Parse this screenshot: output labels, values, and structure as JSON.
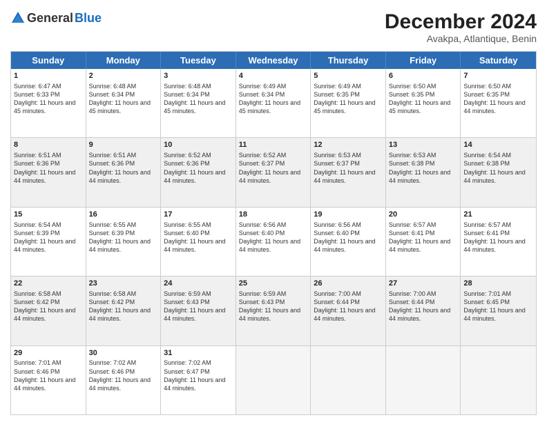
{
  "logo": {
    "general": "General",
    "blue": "Blue"
  },
  "title": {
    "month": "December 2024",
    "location": "Avakpa, Atlantique, Benin"
  },
  "header_days": [
    "Sunday",
    "Monday",
    "Tuesday",
    "Wednesday",
    "Thursday",
    "Friday",
    "Saturday"
  ],
  "rows": [
    [
      {
        "day": "1",
        "sunrise": "Sunrise: 6:47 AM",
        "sunset": "Sunset: 6:33 PM",
        "daylight": "Daylight: 11 hours and 45 minutes."
      },
      {
        "day": "2",
        "sunrise": "Sunrise: 6:48 AM",
        "sunset": "Sunset: 6:34 PM",
        "daylight": "Daylight: 11 hours and 45 minutes."
      },
      {
        "day": "3",
        "sunrise": "Sunrise: 6:48 AM",
        "sunset": "Sunset: 6:34 PM",
        "daylight": "Daylight: 11 hours and 45 minutes."
      },
      {
        "day": "4",
        "sunrise": "Sunrise: 6:49 AM",
        "sunset": "Sunset: 6:34 PM",
        "daylight": "Daylight: 11 hours and 45 minutes."
      },
      {
        "day": "5",
        "sunrise": "Sunrise: 6:49 AM",
        "sunset": "Sunset: 6:35 PM",
        "daylight": "Daylight: 11 hours and 45 minutes."
      },
      {
        "day": "6",
        "sunrise": "Sunrise: 6:50 AM",
        "sunset": "Sunset: 6:35 PM",
        "daylight": "Daylight: 11 hours and 45 minutes."
      },
      {
        "day": "7",
        "sunrise": "Sunrise: 6:50 AM",
        "sunset": "Sunset: 6:35 PM",
        "daylight": "Daylight: 11 hours and 44 minutes."
      }
    ],
    [
      {
        "day": "8",
        "sunrise": "Sunrise: 6:51 AM",
        "sunset": "Sunset: 6:36 PM",
        "daylight": "Daylight: 11 hours and 44 minutes."
      },
      {
        "day": "9",
        "sunrise": "Sunrise: 6:51 AM",
        "sunset": "Sunset: 6:36 PM",
        "daylight": "Daylight: 11 hours and 44 minutes."
      },
      {
        "day": "10",
        "sunrise": "Sunrise: 6:52 AM",
        "sunset": "Sunset: 6:36 PM",
        "daylight": "Daylight: 11 hours and 44 minutes."
      },
      {
        "day": "11",
        "sunrise": "Sunrise: 6:52 AM",
        "sunset": "Sunset: 6:37 PM",
        "daylight": "Daylight: 11 hours and 44 minutes."
      },
      {
        "day": "12",
        "sunrise": "Sunrise: 6:53 AM",
        "sunset": "Sunset: 6:37 PM",
        "daylight": "Daylight: 11 hours and 44 minutes."
      },
      {
        "day": "13",
        "sunrise": "Sunrise: 6:53 AM",
        "sunset": "Sunset: 6:38 PM",
        "daylight": "Daylight: 11 hours and 44 minutes."
      },
      {
        "day": "14",
        "sunrise": "Sunrise: 6:54 AM",
        "sunset": "Sunset: 6:38 PM",
        "daylight": "Daylight: 11 hours and 44 minutes."
      }
    ],
    [
      {
        "day": "15",
        "sunrise": "Sunrise: 6:54 AM",
        "sunset": "Sunset: 6:39 PM",
        "daylight": "Daylight: 11 hours and 44 minutes."
      },
      {
        "day": "16",
        "sunrise": "Sunrise: 6:55 AM",
        "sunset": "Sunset: 6:39 PM",
        "daylight": "Daylight: 11 hours and 44 minutes."
      },
      {
        "day": "17",
        "sunrise": "Sunrise: 6:55 AM",
        "sunset": "Sunset: 6:40 PM",
        "daylight": "Daylight: 11 hours and 44 minutes."
      },
      {
        "day": "18",
        "sunrise": "Sunrise: 6:56 AM",
        "sunset": "Sunset: 6:40 PM",
        "daylight": "Daylight: 11 hours and 44 minutes."
      },
      {
        "day": "19",
        "sunrise": "Sunrise: 6:56 AM",
        "sunset": "Sunset: 6:40 PM",
        "daylight": "Daylight: 11 hours and 44 minutes."
      },
      {
        "day": "20",
        "sunrise": "Sunrise: 6:57 AM",
        "sunset": "Sunset: 6:41 PM",
        "daylight": "Daylight: 11 hours and 44 minutes."
      },
      {
        "day": "21",
        "sunrise": "Sunrise: 6:57 AM",
        "sunset": "Sunset: 6:41 PM",
        "daylight": "Daylight: 11 hours and 44 minutes."
      }
    ],
    [
      {
        "day": "22",
        "sunrise": "Sunrise: 6:58 AM",
        "sunset": "Sunset: 6:42 PM",
        "daylight": "Daylight: 11 hours and 44 minutes."
      },
      {
        "day": "23",
        "sunrise": "Sunrise: 6:58 AM",
        "sunset": "Sunset: 6:42 PM",
        "daylight": "Daylight: 11 hours and 44 minutes."
      },
      {
        "day": "24",
        "sunrise": "Sunrise: 6:59 AM",
        "sunset": "Sunset: 6:43 PM",
        "daylight": "Daylight: 11 hours and 44 minutes."
      },
      {
        "day": "25",
        "sunrise": "Sunrise: 6:59 AM",
        "sunset": "Sunset: 6:43 PM",
        "daylight": "Daylight: 11 hours and 44 minutes."
      },
      {
        "day": "26",
        "sunrise": "Sunrise: 7:00 AM",
        "sunset": "Sunset: 6:44 PM",
        "daylight": "Daylight: 11 hours and 44 minutes."
      },
      {
        "day": "27",
        "sunrise": "Sunrise: 7:00 AM",
        "sunset": "Sunset: 6:44 PM",
        "daylight": "Daylight: 11 hours and 44 minutes."
      },
      {
        "day": "28",
        "sunrise": "Sunrise: 7:01 AM",
        "sunset": "Sunset: 6:45 PM",
        "daylight": "Daylight: 11 hours and 44 minutes."
      }
    ],
    [
      {
        "day": "29",
        "sunrise": "Sunrise: 7:01 AM",
        "sunset": "Sunset: 6:46 PM",
        "daylight": "Daylight: 11 hours and 44 minutes."
      },
      {
        "day": "30",
        "sunrise": "Sunrise: 7:02 AM",
        "sunset": "Sunset: 6:46 PM",
        "daylight": "Daylight: 11 hours and 44 minutes."
      },
      {
        "day": "31",
        "sunrise": "Sunrise: 7:02 AM",
        "sunset": "Sunset: 6:47 PM",
        "daylight": "Daylight: 11 hours and 44 minutes."
      },
      null,
      null,
      null,
      null
    ]
  ]
}
